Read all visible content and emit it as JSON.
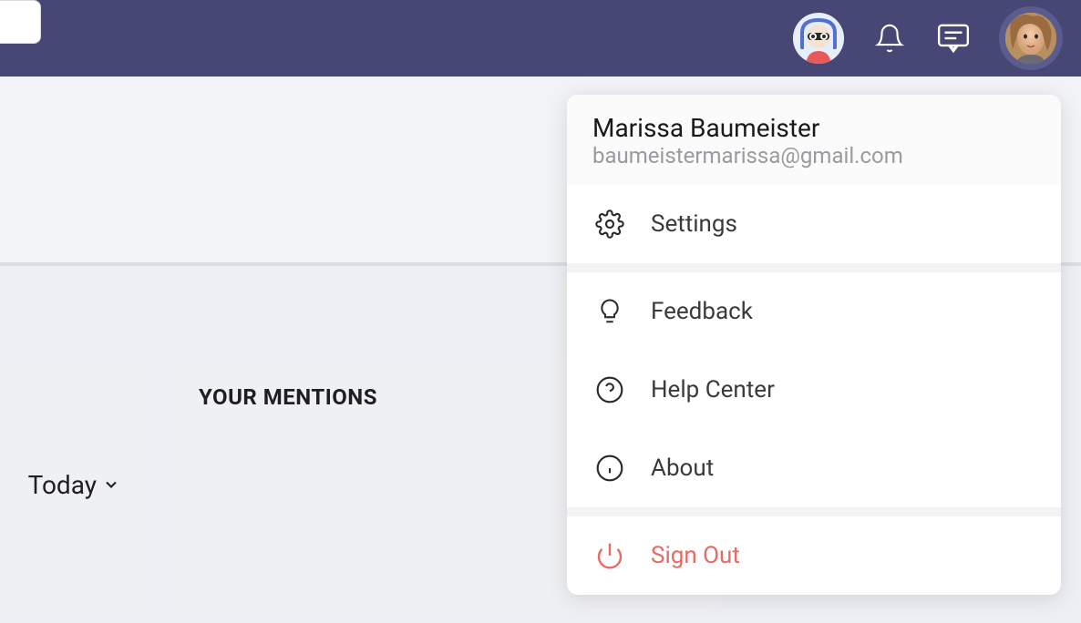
{
  "topbar": {
    "bot_avatar_alt": "assistant-avatar",
    "user_avatar_alt": "profile-avatar"
  },
  "dashboard": {
    "today_label": "Today",
    "mentions_title": "YOUR MENTIONS"
  },
  "profile_menu": {
    "name": "Marissa Baumeister",
    "email": "baumeistermarissa@gmail.com",
    "settings_label": "Settings",
    "feedback_label": "Feedback",
    "help_label": "Help Center",
    "about_label": "About",
    "signout_label": "Sign Out"
  }
}
